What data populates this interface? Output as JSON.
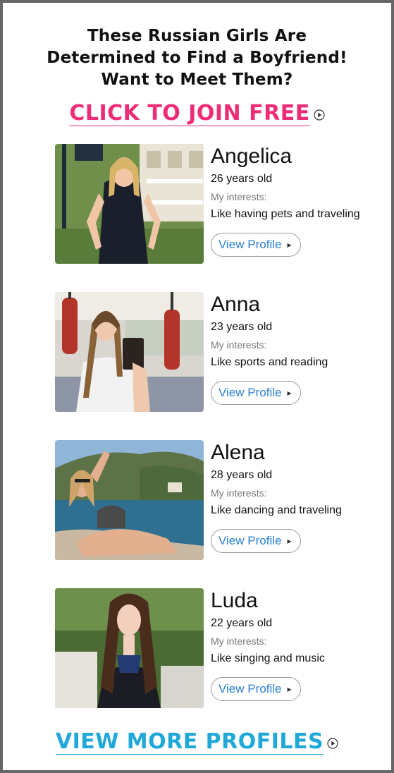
{
  "headline": {
    "line1": "These Russian Girls Are",
    "line2": "Determined to Find a Boyfriend!",
    "line3": "Want to Meet Them?"
  },
  "cta_join": {
    "label": "CLICK TO JOIN FREE",
    "icon": "play-circle-icon",
    "color": "#ee2d78"
  },
  "profiles": [
    {
      "name": "Angelica",
      "age": "26 years old",
      "interests_label": "My interests:",
      "interests": "Like having pets and traveling",
      "button": "View Profile"
    },
    {
      "name": "Anna",
      "age": "23 years old",
      "interests_label": "My interests:",
      "interests": "Like sports and reading",
      "button": "View Profile"
    },
    {
      "name": "Alena",
      "age": "28 years old",
      "interests_label": "My interests:",
      "interests": "Like dancing and traveling",
      "button": "View Profile"
    },
    {
      "name": "Luda",
      "age": "22 years old",
      "interests_label": "My interests:",
      "interests": "Like singing and music",
      "button": "View Profile"
    }
  ],
  "cta_more": {
    "label": "VIEW MORE PROFILES",
    "icon": "play-circle-icon",
    "color": "#1fa8d8"
  },
  "colors": {
    "border": "#666666",
    "button_text": "#2a7fd4"
  }
}
